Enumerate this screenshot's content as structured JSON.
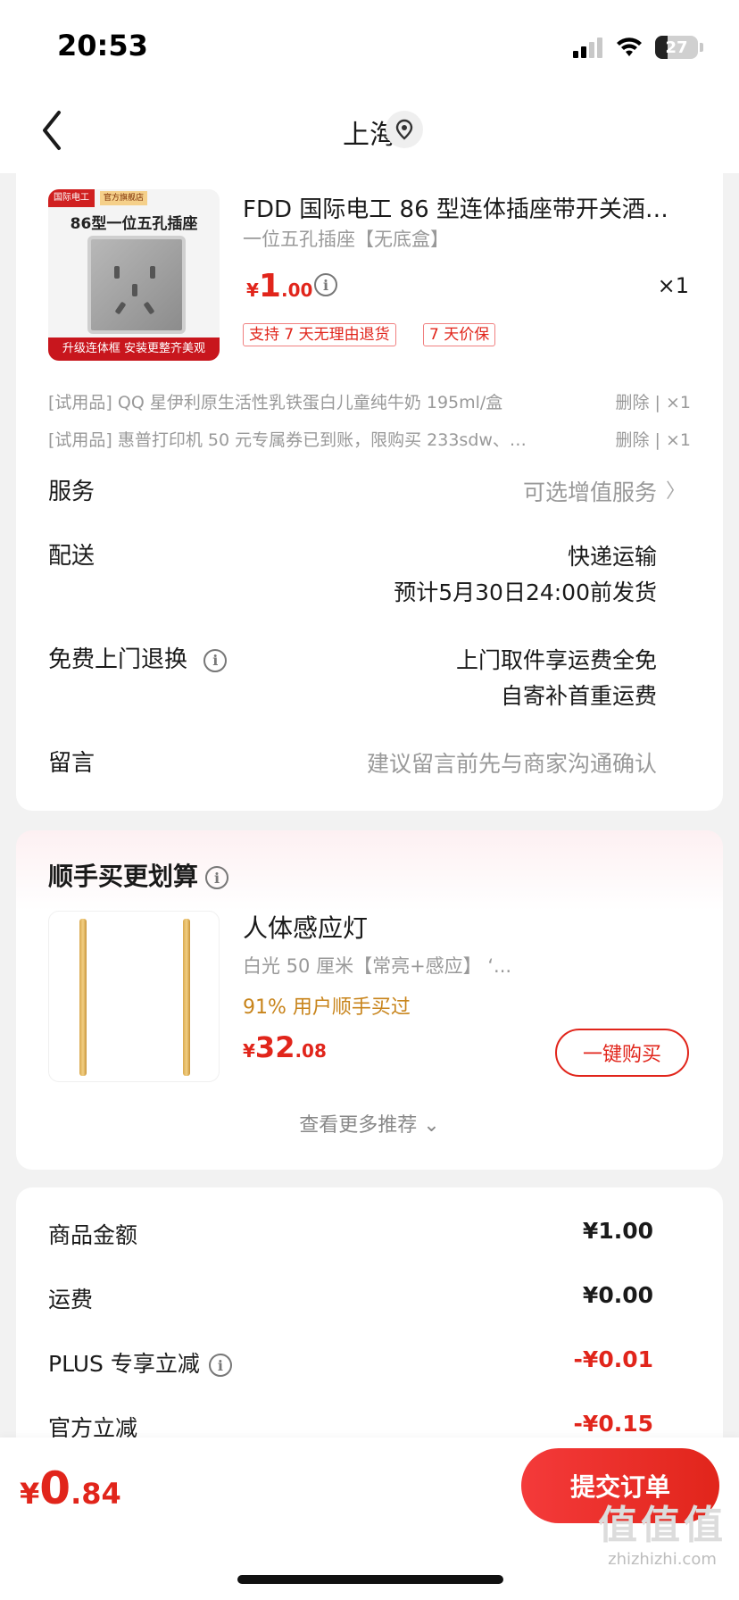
{
  "status_bar": {
    "time": "20:53",
    "battery": "27"
  },
  "nav": {
    "title": "上海"
  },
  "product": {
    "thumb_labels": {
      "brand": "国际电工",
      "shop": "官方旗舰店",
      "title": "86型一位五孔插座",
      "banner": "升级连体框 安装更整齐美观"
    },
    "title": "FDD 国际电工 86 型连体插座带开关酒…",
    "spec": "一位五孔插座【无底盒】",
    "price": {
      "currency": "¥",
      "int": "1",
      "dec": ".00"
    },
    "qty": "×1",
    "tags": [
      "支持 7 天无理由退货",
      "7 天价保"
    ]
  },
  "gifts": [
    {
      "text": "[试用品] QQ 星伊利原生活性乳铁蛋白儿童纯牛奶 195ml/盒",
      "action": "删除 | ×1"
    },
    {
      "text": "[试用品] 惠普打印机 50 元专属券已到账，限购买 233sdw、…",
      "action": "删除 | ×1"
    }
  ],
  "rows": {
    "service": {
      "label": "服务",
      "value": "可选增值服务"
    },
    "delivery": {
      "label": "配送",
      "value1": "快递运输",
      "value2": "预计5月30日24:00前发货"
    },
    "return": {
      "label": "免费上门退换",
      "value1": "上门取件享运费全免",
      "value2": "自寄补首重运费"
    },
    "note": {
      "label": "留言",
      "placeholder": "建议留言前先与商家沟通确认"
    }
  },
  "recommend": {
    "title": "顺手买更划算",
    "name": "人体感应灯",
    "spec": "白光 50 厘米【常亮+感应】 ‘...",
    "hint": "91% 用户顺手买过",
    "price": {
      "currency": "¥",
      "int": "32",
      "dec": ".08"
    },
    "buy_label": "一键购买",
    "more_label": "查看更多推荐 ⌄"
  },
  "summary": [
    {
      "label": "商品金额",
      "value": "¥1.00",
      "red": false,
      "info": false
    },
    {
      "label": "运费",
      "value": "¥0.00",
      "red": false,
      "info": false
    },
    {
      "label": "PLUS 专享立减",
      "value": "-¥0.01",
      "red": true,
      "info": true
    },
    {
      "label": "官方立减",
      "value": "-¥0.15",
      "red": true,
      "info": false
    }
  ],
  "bottom": {
    "total": {
      "currency": "¥",
      "int": "0",
      "dec": ".84"
    },
    "submit_label": "提交订单",
    "watermark_big": "值值值",
    "watermark_small": "zhizhizhi.com"
  },
  "colors": {
    "accent": "#e1251b",
    "hint": "#c8841b",
    "background": "#f2f2f2"
  }
}
